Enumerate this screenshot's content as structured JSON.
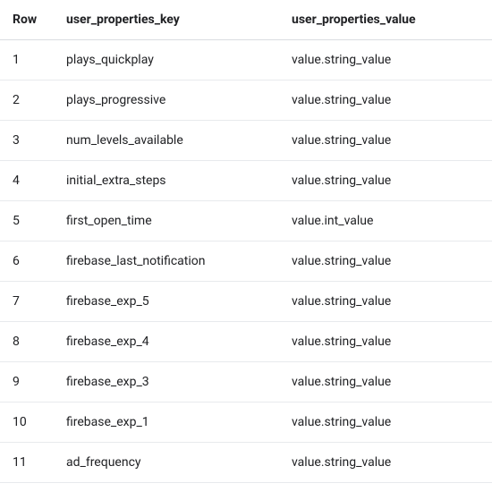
{
  "headers": {
    "row": "Row",
    "key": "user_properties_key",
    "value": "user_properties_value"
  },
  "rows": [
    {
      "num": "1",
      "key": "plays_quickplay",
      "value": "value.string_value"
    },
    {
      "num": "2",
      "key": "plays_progressive",
      "value": "value.string_value"
    },
    {
      "num": "3",
      "key": "num_levels_available",
      "value": "value.string_value"
    },
    {
      "num": "4",
      "key": "initial_extra_steps",
      "value": "value.string_value"
    },
    {
      "num": "5",
      "key": "first_open_time",
      "value": "value.int_value"
    },
    {
      "num": "6",
      "key": "firebase_last_notification",
      "value": "value.string_value"
    },
    {
      "num": "7",
      "key": "firebase_exp_5",
      "value": "value.string_value"
    },
    {
      "num": "8",
      "key": "firebase_exp_4",
      "value": "value.string_value"
    },
    {
      "num": "9",
      "key": "firebase_exp_3",
      "value": "value.string_value"
    },
    {
      "num": "10",
      "key": "firebase_exp_1",
      "value": "value.string_value"
    },
    {
      "num": "11",
      "key": "ad_frequency",
      "value": "value.string_value"
    }
  ]
}
